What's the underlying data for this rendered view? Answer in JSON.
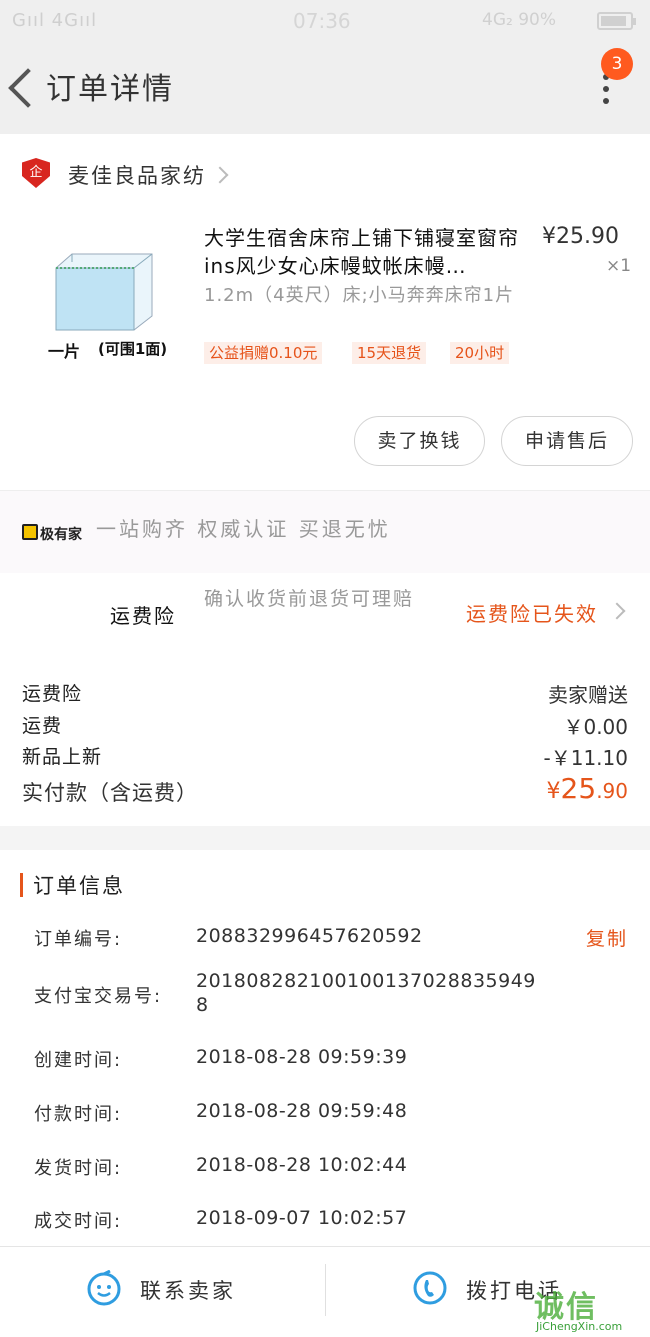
{
  "status_bar": {
    "left": "Gııl 4Gııl",
    "time": "07:36",
    "network": "4G₂",
    "battery_text": "90%",
    "battery_level": 0.9
  },
  "header": {
    "title": "订单详情",
    "badge_count": "3"
  },
  "shop": {
    "logo_text": "企",
    "name": "麦佳良品家纺"
  },
  "product": {
    "image_caption_a": "一片",
    "image_caption_b": "(可围1面)",
    "title": "大学生宿舍床帘上铺下铺寝室窗帘ins风少女心床幔蚊帐床幔…",
    "price": "¥25.90",
    "qty": "×1",
    "sku": "1.2m（4英尺）床;小马奔奔床帘1片",
    "tags": [
      "公益捐赠0.10元",
      "15天退货",
      "20小时"
    ]
  },
  "actions": {
    "sell_button": "卖了换钱",
    "aftersale_button": "申请售后"
  },
  "promo": {
    "logo_text": "极有家",
    "text": "一站购齐 权威认证 买退无忧"
  },
  "insurance": {
    "label": "运费险",
    "desc": "确认收货前退货可理赔",
    "status": "运费险已失效"
  },
  "fees": {
    "rows": [
      {
        "label": "运费险",
        "value": "卖家赠送"
      },
      {
        "label": "运费",
        "value": "￥0.00"
      },
      {
        "label": "新品上新",
        "value": "-￥11.10"
      }
    ],
    "total_label": "实付款（含运费）",
    "total_symbol": "¥",
    "total_int": "25",
    "total_dec": ".90"
  },
  "order_info": {
    "title": "订单信息",
    "copy_label": "复制",
    "rows": [
      {
        "label": "订单编号:",
        "value": "208832996457620592"
      },
      {
        "label": "支付宝交易号:",
        "value": "2018082821001001370288359498"
      },
      {
        "label": "创建时间:",
        "value": "2018-08-28 09:59:39"
      },
      {
        "label": "付款时间:",
        "value": "2018-08-28 09:59:48"
      },
      {
        "label": "发货时间:",
        "value": "2018-08-28 10:02:44"
      },
      {
        "label": "成交时间:",
        "value": "2018-09-07 10:02:57"
      }
    ]
  },
  "bottom": {
    "contact_seller": "联系卖家",
    "call_phone": "拨打电话"
  },
  "watermark": {
    "text": "诚信",
    "url": "JiChengXin.com"
  },
  "colors": {
    "accent": "#e5551b",
    "icon_blue": "#2f9de0"
  }
}
